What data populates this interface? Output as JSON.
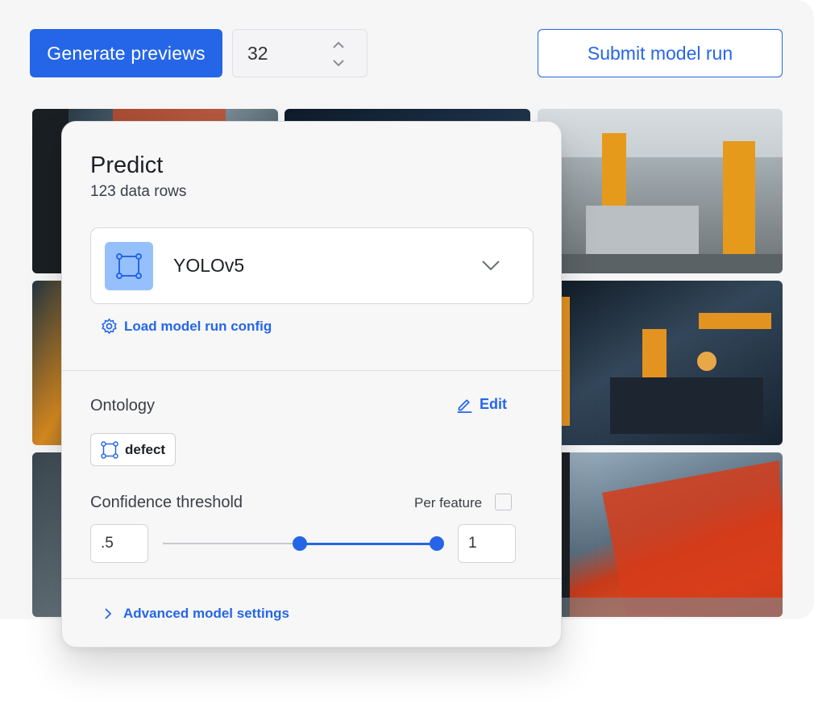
{
  "toolbar": {
    "generate_label": "Generate previews",
    "count_value": "32",
    "submit_label": "Submit model run"
  },
  "panel": {
    "title": "Predict",
    "subtitle": "123 data rows",
    "model": {
      "selected": "YOLOv5",
      "icon": "bounding-box-icon"
    },
    "load_config_label": "Load model run config",
    "ontology": {
      "label": "Ontology",
      "edit_label": "Edit",
      "features": [
        {
          "name": "defect",
          "icon": "bounding-box-icon"
        }
      ]
    },
    "confidence": {
      "label": "Confidence threshold",
      "per_feature_label": "Per feature",
      "per_feature_checked": false,
      "min_value": ".5",
      "max_value": "1",
      "range_min": 0.5,
      "range_max": 1
    },
    "advanced_label": "Advanced model settings"
  },
  "colors": {
    "accent": "#2566e8",
    "model_icon_bg": "#96c0fb"
  }
}
